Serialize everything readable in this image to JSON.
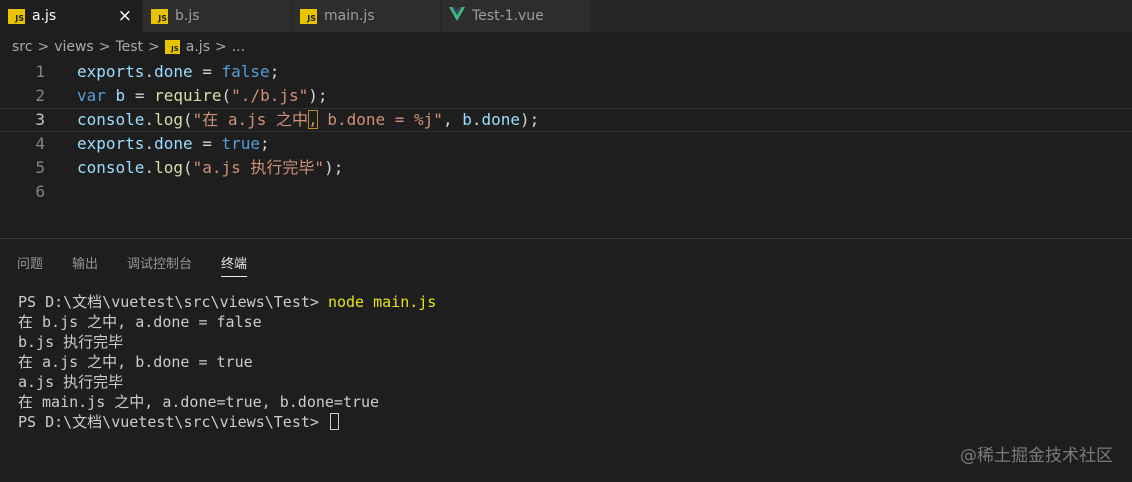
{
  "tabs": [
    {
      "label": "a.js",
      "icon": "js-icon",
      "active": true,
      "close": "×"
    },
    {
      "label": "b.js",
      "icon": "js-icon",
      "active": false
    },
    {
      "label": "main.js",
      "icon": "js-icon",
      "active": false
    },
    {
      "label": "Test-1.vue",
      "icon": "vue-icon",
      "active": false
    }
  ],
  "icons": {
    "js_text": "JS",
    "js_color": "#e8c400",
    "vue_color": "#41b883"
  },
  "breadcrumb": {
    "items": [
      "src",
      "views",
      "Test",
      "a.js",
      "..."
    ],
    "separator": ">"
  },
  "editor": {
    "current_line": 3,
    "line_numbers": [
      "1",
      "2",
      "3",
      "4",
      "5",
      "6"
    ],
    "lines": [
      [
        {
          "t": "exports",
          "c": "var"
        },
        {
          "t": ".",
          "c": "punc"
        },
        {
          "t": "done",
          "c": "var"
        },
        {
          "t": " = ",
          "c": "op"
        },
        {
          "t": "false",
          "c": "kw"
        },
        {
          "t": ";",
          "c": "punc"
        }
      ],
      [
        {
          "t": "var",
          "c": "kw"
        },
        {
          "t": " ",
          "c": "punc"
        },
        {
          "t": "b",
          "c": "var"
        },
        {
          "t": " = ",
          "c": "op"
        },
        {
          "t": "require",
          "c": "fn"
        },
        {
          "t": "(",
          "c": "punc"
        },
        {
          "t": "\"./b.js\"",
          "c": "str"
        },
        {
          "t": ");",
          "c": "punc"
        }
      ],
      [
        {
          "t": "console",
          "c": "var"
        },
        {
          "t": ".",
          "c": "punc"
        },
        {
          "t": "log",
          "c": "fn"
        },
        {
          "t": "(",
          "c": "punc"
        },
        {
          "t": "\"在 a.js 之中",
          "c": "str"
        },
        {
          "t": ",",
          "c": "str",
          "hl": true
        },
        {
          "t": " b.done = %j\"",
          "c": "str"
        },
        {
          "t": ", ",
          "c": "punc"
        },
        {
          "t": "b",
          "c": "var"
        },
        {
          "t": ".",
          "c": "punc"
        },
        {
          "t": "done",
          "c": "var"
        },
        {
          "t": ");",
          "c": "punc"
        }
      ],
      [
        {
          "t": "exports",
          "c": "var"
        },
        {
          "t": ".",
          "c": "punc"
        },
        {
          "t": "done",
          "c": "var"
        },
        {
          "t": " = ",
          "c": "op"
        },
        {
          "t": "true",
          "c": "kw"
        },
        {
          "t": ";",
          "c": "punc"
        }
      ],
      [
        {
          "t": "console",
          "c": "var"
        },
        {
          "t": ".",
          "c": "punc"
        },
        {
          "t": "log",
          "c": "fn"
        },
        {
          "t": "(",
          "c": "punc"
        },
        {
          "t": "\"a.js 执行完毕\"",
          "c": "str"
        },
        {
          "t": ");",
          "c": "punc"
        }
      ],
      []
    ]
  },
  "panel": {
    "tabs": [
      "问题",
      "输出",
      "调试控制台",
      "终端"
    ],
    "active_tab": 3
  },
  "terminal": {
    "prompt": "PS D:\\文档\\vuetest\\src\\views\\Test> ",
    "command": "node main.js",
    "output": [
      "在 b.js 之中, a.done = false",
      "b.js 执行完毕",
      "在 a.js 之中, b.done = true",
      "a.js 执行完毕",
      "在 main.js 之中, a.done=true, b.done=true"
    ],
    "final_prompt": "PS D:\\文档\\vuetest\\src\\views\\Test> "
  },
  "watermark": "@稀土掘金技术社区"
}
